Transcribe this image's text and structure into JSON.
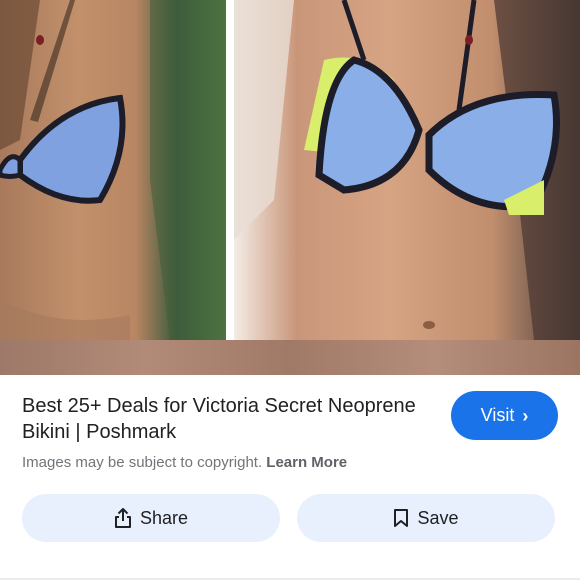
{
  "result": {
    "title": "Best 25+ Deals for Victoria Secret Neoprene Bikini | Poshmark",
    "visit_label": "Visit",
    "visit_icon": "chevron-right-icon",
    "copyright_text": "Images may be subject to copyright.",
    "learn_more_label": "Learn More"
  },
  "actions": {
    "share_label": "Share",
    "share_icon": "share-icon",
    "save_label": "Save",
    "save_icon": "bookmark-icon"
  },
  "colors": {
    "accent": "#1a73e8",
    "action_bg": "#e8f0fe",
    "muted_text": "#70757a"
  }
}
